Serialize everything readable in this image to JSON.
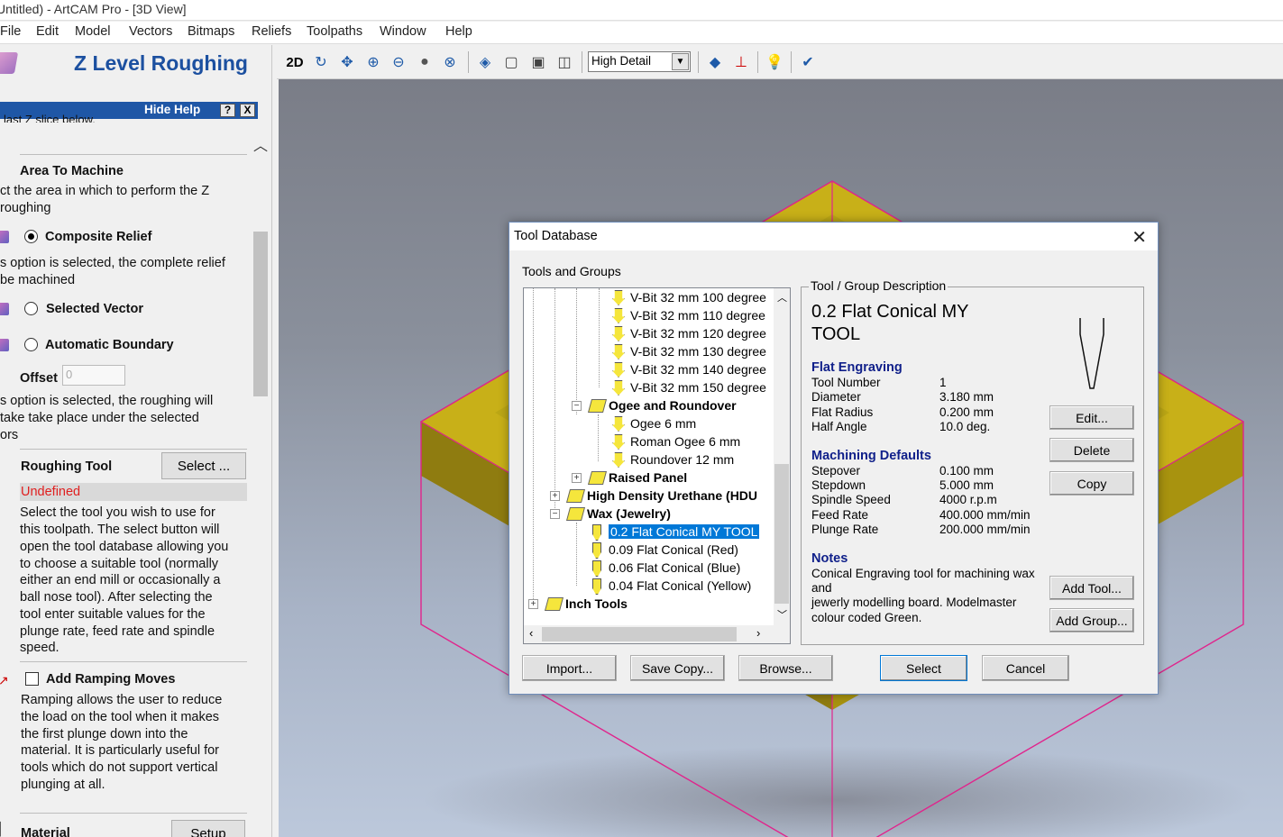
{
  "window": {
    "title": "Untitled) - ArtCAM Pro - [3D View]"
  },
  "menu": [
    "File",
    "Edit",
    "Model",
    "Vectors",
    "Bitmaps",
    "Reliefs",
    "Toolpaths",
    "Window",
    "Help"
  ],
  "toolbar": {
    "mode_2d": "2D",
    "detail_value": "High Detail"
  },
  "left_panel": {
    "title": "Z Level Roughing",
    "hide_help": "Hide Help",
    "help_q": "?",
    "help_x": "X",
    "clipped_text": "last Z slice below.",
    "area_heading": "Area To Machine",
    "area_desc": [
      "ct the area in which to perform the Z",
      " roughing"
    ],
    "opt_composite": "Composite Relief",
    "composite_desc": [
      "s option is selected, the complete relief",
      "be machined"
    ],
    "opt_selected_vector": "Selected Vector",
    "opt_auto_boundary": "Automatic Boundary",
    "offset_label": "Offset",
    "offset_value": "0",
    "boundary_desc": [
      "s option is selected, the roughing will",
      "take take place under the selected",
      "ors"
    ],
    "roughing_tool_label": "Roughing Tool",
    "select_button": "Select ...",
    "tool_status": "Undefined",
    "tool_desc": [
      "Select the tool you wish to use for",
      "this toolpath. The select button will",
      "open the tool database allowing you",
      "to choose a suitable tool (normally",
      "either an end mill or occasionally a",
      "ball nose tool). After selecting the",
      "tool enter suitable values for the",
      "plunge rate, feed rate and spindle",
      "speed."
    ],
    "ramping_label": "Add Ramping Moves",
    "ramping_desc": [
      "Ramping allows the user to reduce",
      "the load on the tool when it makes",
      "the first plunge down into the",
      "material. It is particularly useful for",
      "tools which do not support vertical",
      "plunging at all."
    ],
    "material_label": "Material",
    "setup_button": "Setup"
  },
  "dialog": {
    "title": "Tool Database",
    "close": "✕",
    "tools_groups_label": "Tools and Groups",
    "tree": [
      {
        "label": "V-Bit 32 mm 100 degree",
        "type": "bit"
      },
      {
        "label": "V-Bit 32 mm 110 degree",
        "type": "bit"
      },
      {
        "label": "V-Bit 32 mm 120 degree",
        "type": "bit"
      },
      {
        "label": "V-Bit 32 mm 130 degree",
        "type": "bit"
      },
      {
        "label": "V-Bit 32 mm 140 degree",
        "type": "bit"
      },
      {
        "label": "V-Bit 32 mm 150 degree",
        "type": "bit"
      },
      {
        "label": "Ogee and Roundover",
        "type": "group",
        "expander": "−"
      },
      {
        "label": "Ogee 6 mm",
        "type": "bit"
      },
      {
        "label": "Roman Ogee 6 mm",
        "type": "bit"
      },
      {
        "label": "Roundover 12 mm",
        "type": "bit"
      },
      {
        "label": "Raised Panel",
        "type": "group",
        "expander": "+"
      },
      {
        "label": "High Density Urethane (HDU",
        "type": "group",
        "expander": "+"
      },
      {
        "label": "Wax (Jewelry)",
        "type": "group",
        "expander": "−"
      },
      {
        "label": "0.2 Flat Conical  MY TOOL",
        "type": "flat",
        "selected": true
      },
      {
        "label": "0.09 Flat Conical  (Red)",
        "type": "flat"
      },
      {
        "label": "0.06 Flat Conical  (Blue)",
        "type": "flat"
      },
      {
        "label": "0.04 Flat Conical  (Yellow)",
        "type": "flat"
      },
      {
        "label": "Inch Tools",
        "type": "group",
        "expander": "+"
      }
    ],
    "desc_legend": "Tool / Group Description",
    "tool_name_line1": "0.2 Flat Conical  MY",
    "tool_name_line2": "TOOL",
    "tool_type": "Flat Engraving",
    "props": [
      {
        "k": "Tool Number",
        "v": "1"
      },
      {
        "k": "Diameter",
        "v": "3.180 mm"
      },
      {
        "k": "Flat Radius",
        "v": "0.200 mm"
      },
      {
        "k": "Half Angle",
        "v": "10.0 deg."
      }
    ],
    "machining_heading": "Machining Defaults",
    "machining": [
      {
        "k": "Stepover",
        "v": "0.100 mm"
      },
      {
        "k": "Stepdown",
        "v": "5.000 mm"
      },
      {
        "k": "Spindle Speed",
        "v": "4000 r.p.m"
      },
      {
        "k": "Feed Rate",
        "v": "400.000 mm/min"
      },
      {
        "k": "Plunge Rate",
        "v": "200.000 mm/min"
      }
    ],
    "notes_heading": "Notes",
    "notes": [
      "Conical Engraving tool for machining wax",
      "and",
      "jewerly modelling board. Modelmaster",
      "colour coded Green."
    ],
    "buttons": {
      "edit": "Edit...",
      "delete": "Delete",
      "copy": "Copy",
      "add_tool": "Add Tool...",
      "add_group": "Add Group...",
      "import": "Import...",
      "save_copy": "Save Copy...",
      "browse": "Browse...",
      "select": "Select",
      "cancel": "Cancel"
    }
  }
}
